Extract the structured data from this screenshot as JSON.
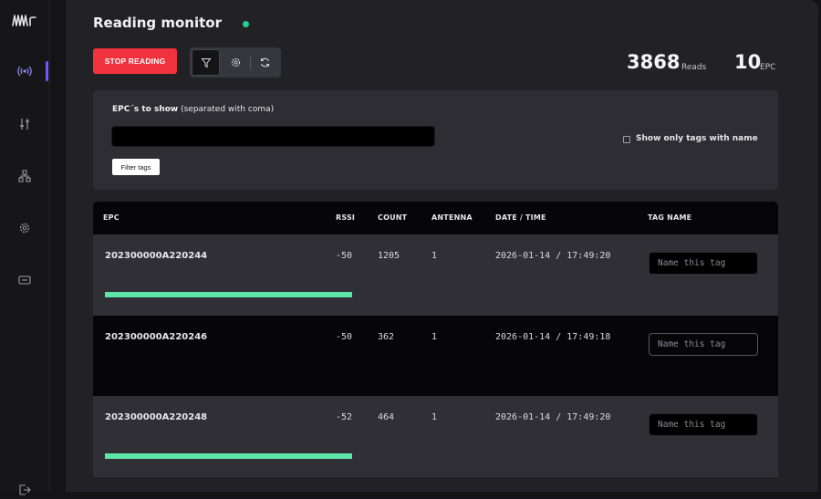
{
  "page": {
    "title": "Reading monitor",
    "status_color": "#22d38a",
    "stop_button": "STOP READING",
    "tools": [
      {
        "icon": "filter-icon"
      },
      {
        "icon": "gear-icon"
      },
      {
        "icon": "refresh-icon"
      }
    ],
    "stats": {
      "reads_value": "3868",
      "reads_label": "Reads",
      "epc_value": "10",
      "epc_label": "EPC"
    }
  },
  "sidebar": {
    "active_color": "#6b5cff",
    "items": [
      {
        "icon": "antenna-icon",
        "active": true
      },
      {
        "icon": "sliders-icon"
      },
      {
        "icon": "network-icon"
      },
      {
        "icon": "settings-icon"
      },
      {
        "icon": "device-icon"
      },
      {
        "icon": "logout-icon"
      }
    ]
  },
  "filter": {
    "label_bold": "EPC´s to show",
    "label_hint": " (separated with coma)",
    "input_value": "",
    "button": "Filter tags",
    "checkbox_label": "Show only tags with name",
    "checkbox_checked": false
  },
  "table": {
    "columns": [
      "EPC",
      "RSSI",
      "COUNT",
      "ANTENNA",
      "DATE / TIME",
      "TAG NAME"
    ],
    "name_placeholder": "Name this tag",
    "bar_color": "#5ee6a9",
    "rows": [
      {
        "epc": "202300000A220244",
        "rssi": "-50",
        "count": "1205",
        "antenna": "1",
        "datetime": "2026-01-14 / 17:49:20",
        "signal": 1.0
      },
      {
        "epc": "202300000A220246",
        "rssi": "-50",
        "count": "362",
        "antenna": "1",
        "datetime": "2026-01-14 / 17:49:18",
        "signal": 0
      },
      {
        "epc": "202300000A220248",
        "rssi": "-52",
        "count": "464",
        "antenna": "1",
        "datetime": "2026-01-14 / 17:49:20",
        "signal": 1.0
      }
    ]
  }
}
